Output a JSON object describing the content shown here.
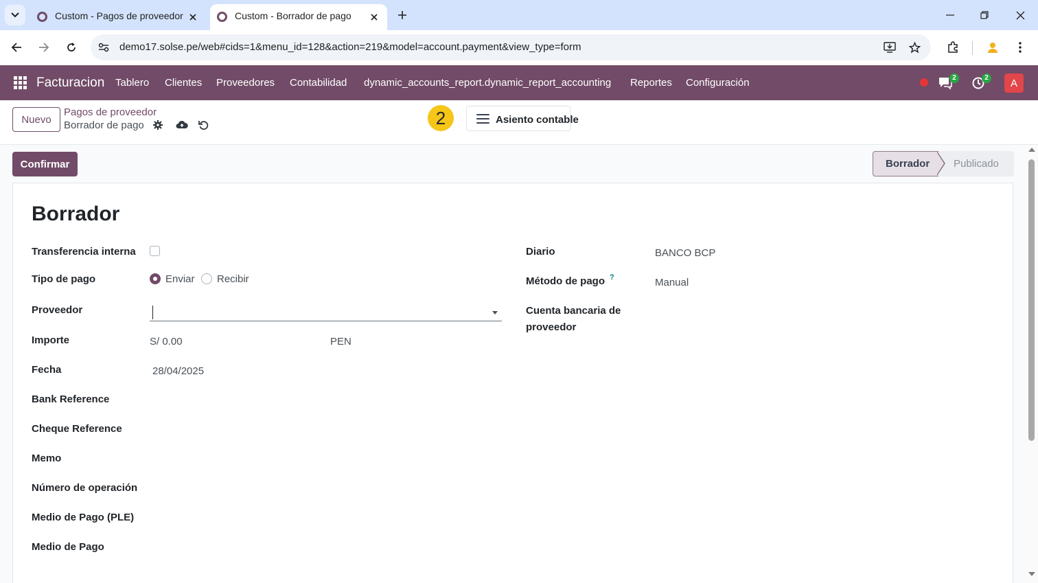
{
  "browser": {
    "tabs": [
      {
        "title": "Custom - Pagos de proveedor",
        "active": false
      },
      {
        "title": "Custom - Borrador de pago",
        "active": true
      }
    ],
    "url": "demo17.solse.pe/web#cids=1&menu_id=128&action=219&model=account.payment&view_type=form",
    "icons": [
      "tab-search-icon",
      "close-icon",
      "plus-icon",
      "minimize-icon",
      "restore-icon",
      "window-close-icon",
      "back-arrow-icon",
      "forward-arrow-icon",
      "reload-icon",
      "site-info-icon",
      "install-app-icon",
      "star-icon",
      "extensions-icon",
      "profile-icon",
      "kebab-menu-icon"
    ]
  },
  "navbar": {
    "brand": "Facturacion",
    "menu": [
      "Tablero",
      "Clientes",
      "Proveedores",
      "Contabilidad",
      "dynamic_accounts_report.dynamic_report_accounting",
      "Reportes",
      "Configuración"
    ],
    "messages_count": "2",
    "activities_count": "2",
    "avatar_initial": "A",
    "colors": {
      "primary": "#714b67",
      "badge": "#28a745",
      "avatar": "#e0464a"
    }
  },
  "control_panel": {
    "new_label": "Nuevo",
    "breadcrumb": "Pagos de proveedor",
    "record_name": "Borrador de pago",
    "step_number": "2",
    "smart_button": "Asiento contable"
  },
  "statusbar": {
    "confirm_label": "Confirmar",
    "stages": [
      "Borrador",
      "Publicado"
    ],
    "current_stage": "Borrador"
  },
  "form": {
    "title": "Borrador",
    "left": {
      "internal_transfer": {
        "label": "Transferencia interna",
        "checked": false
      },
      "payment_type": {
        "label": "Tipo de pago",
        "options": [
          "Enviar",
          "Recibir"
        ],
        "selected": "Enviar"
      },
      "partner": {
        "label": "Proveedor",
        "value": ""
      },
      "amount": {
        "label": "Importe",
        "value": "S/ 0.00",
        "currency": "PEN"
      },
      "date": {
        "label": "Fecha",
        "value": "28/04/2025"
      },
      "bank_reference": {
        "label": "Bank Reference"
      },
      "cheque_reference": {
        "label": "Cheque Reference"
      },
      "memo": {
        "label": "Memo"
      },
      "operation_number": {
        "label": "Número de operación"
      },
      "payment_medium_ple": {
        "label": "Medio de Pago (PLE)"
      },
      "payment_medium": {
        "label": "Medio de Pago"
      }
    },
    "right": {
      "journal": {
        "label": "Diario",
        "value": "BANCO BCP"
      },
      "payment_method": {
        "label": "Método de pago",
        "help": "?",
        "value": "Manual"
      },
      "partner_bank": {
        "label_line1": "Cuenta bancaria de",
        "label_line2": "proveedor"
      }
    }
  }
}
